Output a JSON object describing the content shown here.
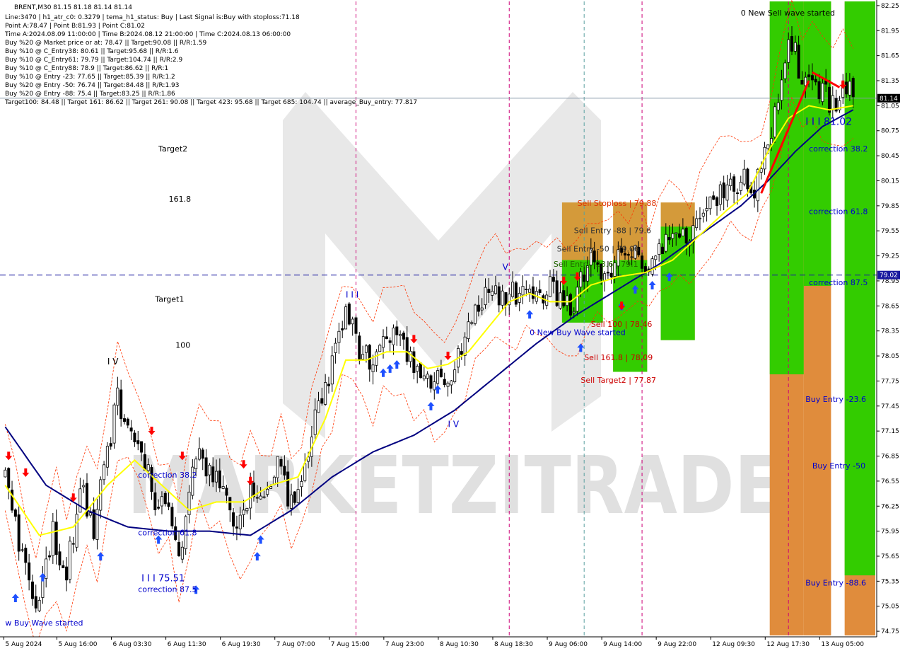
{
  "info": {
    "title": "BRENT,M30  81.15 81.18 81.14 81.14",
    "lines": [
      "Line:3470 | h1_atr_c0: 0.3279 | tema_h1_status: Buy | Last Signal is:Buy with stoploss:71.18",
      "Point A:78.47 | Point B:81.93 | Point C:81.02",
      "Time A:2024.08.09 11:00:00 | Time B:2024.08.12 21:00:00 | Time C:2024.08.13 06:00:00",
      "Buy %20 @ Market price or at: 78.47 || Target:90.08 || R/R:1.59",
      "Buy %10 @ C_Entry38: 80.61 || Target:95.68 || R/R:1.6",
      "Buy %10 @ C_Entry61: 79.79 || Target:104.74 || R/R:2.9",
      "Buy %10 @ C_Entry88: 78.9 || Target:86.62 || R/R:1",
      "Buy %10 @ Entry -23: 77.65 || Target:85.39 || R/R:1.2",
      "Buy %20 @ Entry -50: 76.74 || Target:84.48 || R/R:1.93",
      "Buy %20 @ Entry -88: 75.4 || Target:83.25 || R/R:1.86",
      "Target100: 84.48 || Target 161: 86.62 || Target 261: 90.08 || Target 423: 95.68 || Target 685: 104.74 || average_Buy_entry: 77.817"
    ]
  },
  "colors": {
    "candle": "#000000",
    "ma_slow": "#000080",
    "ma_fast": "#ffff00",
    "green_zone": "#33cc00",
    "orange_zone": "#e08c3c",
    "buy_arrow": "#1e50ff",
    "sell_arrow": "#ff0000",
    "channel": "#ff3300",
    "watermark": "#d9d9d9",
    "blue_text": "#0000cc",
    "red_text": "#cc0000"
  },
  "chart_data": {
    "type": "candlestick",
    "symbol": "BRENT",
    "timeframe": "M30",
    "ylim": [
      74.7,
      82.3
    ],
    "price_ticks": [
      82.25,
      81.95,
      81.65,
      81.35,
      81.05,
      80.75,
      80.45,
      80.15,
      79.85,
      79.55,
      79.25,
      78.95,
      78.65,
      78.35,
      78.05,
      77.75,
      77.45,
      77.15,
      76.85,
      76.55,
      76.25,
      75.95,
      75.65,
      75.35,
      75.05,
      74.75
    ],
    "price_tick_labels": [
      "82.25",
      "81.95",
      "81.65",
      "81.35",
      "81.05",
      "80.75",
      "80.45",
      "80.15",
      "79.85",
      "79.55",
      "79.25",
      "78.95",
      "78.65",
      "78.35",
      "78.05",
      "77.75",
      "77.45",
      "77.15",
      "76.85",
      "76.55",
      "76.25",
      "75.95",
      "75.65",
      "75.35",
      "75.05",
      "74.75"
    ],
    "time_labels": [
      "5 Aug 2024",
      "5 Aug 16:00",
      "6 Aug 03:30",
      "6 Aug 11:30",
      "6 Aug 19:30",
      "7 Aug 07:00",
      "7 Aug 15:00",
      "7 Aug 23:00",
      "8 Aug 10:30",
      "8 Aug 18:30",
      "9 Aug 06:00",
      "9 Aug 14:00",
      "9 Aug 22:00",
      "12 Aug 09:30",
      "12 Aug 17:30",
      "13 Aug 05:00"
    ],
    "time_label_bars": [
      0,
      16,
      32,
      48,
      64,
      80,
      96,
      112,
      128,
      144,
      160,
      176,
      192,
      208,
      224,
      240
    ],
    "bar_count": 250,
    "current_price": 81.14,
    "current_price_label": "81.14",
    "level_line": 79.02,
    "level_line_label": "79.02",
    "close_path": [
      [
        0,
        76.6
      ],
      [
        6,
        75.5
      ],
      [
        10,
        75.1
      ],
      [
        14,
        75.9
      ],
      [
        18,
        75.4
      ],
      [
        22,
        76.5
      ],
      [
        26,
        76.0
      ],
      [
        30,
        76.9
      ],
      [
        33,
        77.6
      ],
      [
        36,
        77.1
      ],
      [
        40,
        77.0
      ],
      [
        44,
        76.3
      ],
      [
        48,
        76.2
      ],
      [
        52,
        75.7
      ],
      [
        56,
        76.9
      ],
      [
        60,
        76.6
      ],
      [
        64,
        76.4
      ],
      [
        68,
        76.1
      ],
      [
        72,
        76.4
      ],
      [
        76,
        76.5
      ],
      [
        80,
        76.7
      ],
      [
        84,
        76.3
      ],
      [
        88,
        76.8
      ],
      [
        92,
        77.4
      ],
      [
        96,
        78.0
      ],
      [
        100,
        78.6
      ],
      [
        104,
        78.1
      ],
      [
        108,
        78.0
      ],
      [
        112,
        78.2
      ],
      [
        116,
        78.3
      ],
      [
        120,
        78.0
      ],
      [
        124,
        77.8
      ],
      [
        128,
        77.7
      ],
      [
        132,
        77.9
      ],
      [
        136,
        78.3
      ],
      [
        140,
        78.7
      ],
      [
        144,
        78.9
      ],
      [
        147,
        78.7
      ],
      [
        150,
        78.8
      ],
      [
        154,
        78.9
      ],
      [
        157,
        78.8
      ],
      [
        160,
        78.95
      ],
      [
        164,
        78.6
      ],
      [
        168,
        78.8
      ],
      [
        172,
        79.2
      ],
      [
        176,
        78.9
      ],
      [
        180,
        79.2
      ],
      [
        184,
        79.4
      ],
      [
        188,
        79.1
      ],
      [
        192,
        79.3
      ],
      [
        196,
        79.4
      ],
      [
        200,
        79.5
      ],
      [
        204,
        79.7
      ],
      [
        208,
        79.9
      ],
      [
        212,
        80.0
      ],
      [
        216,
        80.2
      ],
      [
        220,
        80.0
      ],
      [
        223,
        80.4
      ],
      [
        226,
        81.0
      ],
      [
        229,
        81.6
      ],
      [
        231,
        81.75
      ],
      [
        234,
        81.4
      ],
      [
        237,
        81.35
      ],
      [
        240,
        81.2
      ],
      [
        243,
        81.0
      ],
      [
        246,
        81.3
      ],
      [
        249,
        81.14
      ]
    ],
    "ma_slow_path": [
      [
        0,
        77.2
      ],
      [
        12,
        76.5
      ],
      [
        24,
        76.2
      ],
      [
        36,
        76.0
      ],
      [
        48,
        75.95
      ],
      [
        60,
        75.95
      ],
      [
        72,
        75.9
      ],
      [
        84,
        76.2
      ],
      [
        96,
        76.6
      ],
      [
        108,
        76.9
      ],
      [
        120,
        77.1
      ],
      [
        132,
        77.4
      ],
      [
        144,
        77.8
      ],
      [
        156,
        78.2
      ],
      [
        168,
        78.55
      ],
      [
        180,
        78.85
      ],
      [
        192,
        79.15
      ],
      [
        204,
        79.5
      ],
      [
        216,
        79.85
      ],
      [
        224,
        80.15
      ],
      [
        232,
        80.5
      ],
      [
        240,
        80.8
      ],
      [
        249,
        81.0
      ]
    ],
    "ma_fast_path": [
      [
        0,
        76.5
      ],
      [
        10,
        75.9
      ],
      [
        20,
        76.0
      ],
      [
        30,
        76.5
      ],
      [
        38,
        76.8
      ],
      [
        46,
        76.5
      ],
      [
        54,
        76.2
      ],
      [
        62,
        76.3
      ],
      [
        70,
        76.3
      ],
      [
        78,
        76.5
      ],
      [
        86,
        76.6
      ],
      [
        94,
        77.3
      ],
      [
        100,
        78.0
      ],
      [
        106,
        78.0
      ],
      [
        112,
        78.1
      ],
      [
        118,
        78.1
      ],
      [
        124,
        77.9
      ],
      [
        130,
        77.95
      ],
      [
        136,
        78.1
      ],
      [
        142,
        78.4
      ],
      [
        148,
        78.7
      ],
      [
        154,
        78.8
      ],
      [
        160,
        78.7
      ],
      [
        166,
        78.7
      ],
      [
        172,
        78.9
      ],
      [
        180,
        79.0
      ],
      [
        188,
        79.05
      ],
      [
        196,
        79.2
      ],
      [
        204,
        79.5
      ],
      [
        212,
        79.8
      ],
      [
        218,
        80.0
      ],
      [
        224,
        80.5
      ],
      [
        230,
        80.9
      ],
      [
        236,
        81.05
      ],
      [
        242,
        81.0
      ],
      [
        249,
        81.05
      ]
    ]
  },
  "vertical_lines": [
    {
      "bar": 103,
      "color": "#cc0077"
    },
    {
      "bar": 148,
      "color": "#cc0077"
    },
    {
      "bar": 170,
      "color": "#5aa0a0"
    },
    {
      "bar": 187,
      "color": "#cc0077"
    },
    {
      "bar": 230,
      "color": "#cc0077"
    }
  ],
  "zones": [
    {
      "bar_from": 164,
      "bar_to": 175,
      "price_from": 78.45,
      "price_to": 79.89,
      "color": "#d49a3a"
    },
    {
      "bar_from": 164,
      "bar_to": 175,
      "price_from": 78.45,
      "price_to": 79.2,
      "color": "#33cc00"
    },
    {
      "bar_from": 179,
      "bar_to": 188,
      "price_from": 77.86,
      "price_to": 79.89,
      "color": "#d49a3a"
    },
    {
      "bar_from": 179,
      "bar_to": 188,
      "price_from": 77.86,
      "price_to": 79.2,
      "color": "#33cc00"
    },
    {
      "bar_from": 193,
      "bar_to": 202,
      "price_from": 78.24,
      "price_to": 79.89,
      "color": "#d49a3a"
    },
    {
      "bar_from": 193,
      "bar_to": 202,
      "price_from": 78.24,
      "price_to": 79.6,
      "color": "#33cc00"
    },
    {
      "bar_from": 225,
      "bar_to": 234,
      "price_from": 74.7,
      "price_to": 82.3,
      "color": "#e08c3c"
    },
    {
      "bar_from": 225,
      "bar_to": 234,
      "price_from": 77.83,
      "price_to": 82.3,
      "color": "#33cc00"
    },
    {
      "bar_from": 235,
      "bar_to": 242,
      "price_from": 74.7,
      "price_to": 82.3,
      "color": "#e08c3c"
    },
    {
      "bar_from": 235,
      "bar_to": 242,
      "price_from": 78.89,
      "price_to": 82.3,
      "color": "#33cc00"
    },
    {
      "bar_from": 247,
      "bar_to": 256,
      "price_from": 74.7,
      "price_to": 82.3,
      "color": "#e08c3c"
    },
    {
      "bar_from": 247,
      "bar_to": 256,
      "price_from": 75.42,
      "price_to": 82.3,
      "color": "#33cc00"
    }
  ],
  "annotations": [
    {
      "text": "0 New Sell wave started",
      "bar": 216,
      "price": 82.13,
      "color": "#000000",
      "size": 11
    },
    {
      "text": "Target2",
      "bar": 45,
      "price": 80.5,
      "color": "#000000",
      "size": 11
    },
    {
      "text": "161.8",
      "bar": 48,
      "price": 79.9,
      "color": "#000000",
      "size": 11
    },
    {
      "text": "Target1",
      "bar": 44,
      "price": 78.7,
      "color": "#000000",
      "size": 11
    },
    {
      "text": "100",
      "bar": 50,
      "price": 78.15,
      "color": "#000000",
      "size": 11
    },
    {
      "text": "I V",
      "bar": 30,
      "price": 77.95,
      "color": "#000000",
      "size": 12
    },
    {
      "text": "I I I",
      "bar": 100,
      "price": 78.75,
      "color": "#0000cc",
      "size": 12
    },
    {
      "text": "V",
      "bar": 146,
      "price": 79.08,
      "color": "#0000cc",
      "size": 12
    },
    {
      "text": "I V",
      "bar": 130,
      "price": 77.2,
      "color": "#0000cc",
      "size": 12
    },
    {
      "text": "Sell Stoploss | 79.88",
      "bar": 168,
      "price": 79.85,
      "color": "#e03000",
      "size": 11
    },
    {
      "text": "Sell Entry -88 | 79.6",
      "bar": 167,
      "price": 79.52,
      "color": "#333333",
      "size": 11
    },
    {
      "text": "Sell Entry -50 | 79.06",
      "bar": 162,
      "price": 79.3,
      "color": "#333333",
      "size": 11
    },
    {
      "text": "Sell Entry -23.6 | 79.1",
      "bar": 161,
      "price": 79.12,
      "color": "#226600",
      "size": 11
    },
    {
      "text": "Sell 100 | 78.46",
      "bar": 172,
      "price": 78.4,
      "color": "#cc0000",
      "size": 11
    },
    {
      "text": "0 New Buy Wave started",
      "bar": 154,
      "price": 78.3,
      "color": "#0000cc",
      "size": 11
    },
    {
      "text": "Sell 161.8 | 78.09",
      "bar": 170,
      "price": 78.0,
      "color": "#cc0000",
      "size": 11
    },
    {
      "text": "Sell Target2 | 77.87",
      "bar": 169,
      "price": 77.73,
      "color": "#cc0000",
      "size": 11
    },
    {
      "text": "correction 38.2",
      "bar": 39,
      "price": 76.59,
      "color": "#0000cc",
      "size": 11
    },
    {
      "text": "correction 61.8",
      "bar": 39,
      "price": 75.9,
      "color": "#0000cc",
      "size": 11
    },
    {
      "text": "correction 87.5",
      "bar": 39,
      "price": 75.22,
      "color": "#0000cc",
      "size": 11
    },
    {
      "text": "I I I 75.51",
      "bar": 40,
      "price": 75.35,
      "color": "#0000cc",
      "size": 13
    },
    {
      "text": "w Buy Wave started",
      "bar": 0,
      "price": 74.82,
      "color": "#0000cc",
      "size": 11
    },
    {
      "text": "I I I 81.02",
      "bar": 235,
      "price": 80.82,
      "color": "#0000cc",
      "size": 14
    },
    {
      "text": "correction 38.2",
      "bar": 236,
      "price": 80.5,
      "color": "#0000cc",
      "size": 11
    },
    {
      "text": "correction 61.8",
      "bar": 236,
      "price": 79.75,
      "color": "#0000cc",
      "size": 11
    },
    {
      "text": "correction 87.5",
      "bar": 236,
      "price": 78.9,
      "color": "#0000cc",
      "size": 11
    },
    {
      "text": "Buy Entry -23.6",
      "bar": 235,
      "price": 77.5,
      "color": "#0000cc",
      "size": 11
    },
    {
      "text": "Buy Entry -50",
      "bar": 237,
      "price": 76.7,
      "color": "#0000cc",
      "size": 11
    },
    {
      "text": "Buy Entry -88.6",
      "bar": 235,
      "price": 75.3,
      "color": "#0000cc",
      "size": 11
    }
  ],
  "buy_arrows": [
    [
      3,
      75.2
    ],
    [
      11,
      75.45
    ],
    [
      28,
      75.7
    ],
    [
      45,
      75.9
    ],
    [
      56,
      75.3
    ],
    [
      74,
      75.7
    ],
    [
      75,
      75.9
    ],
    [
      111,
      77.9
    ],
    [
      113,
      77.95
    ],
    [
      115,
      78.0
    ],
    [
      125,
      77.5
    ],
    [
      127,
      77.7
    ],
    [
      154,
      78.6
    ],
    [
      169,
      78.2
    ],
    [
      181,
      78.7
    ],
    [
      185,
      78.9
    ],
    [
      190,
      78.95
    ],
    [
      195,
      79.05
    ]
  ],
  "sell_arrows": [
    [
      1,
      76.8
    ],
    [
      6,
      76.6
    ],
    [
      20,
      76.3
    ],
    [
      43,
      77.1
    ],
    [
      52,
      76.8
    ],
    [
      70,
      76.7
    ],
    [
      72,
      76.5
    ],
    [
      120,
      78.2
    ],
    [
      130,
      78.0
    ],
    [
      164,
      78.9
    ],
    [
      168,
      78.95
    ],
    [
      181,
      78.6
    ],
    [
      246,
      81.25
    ]
  ],
  "trend_line_red": [
    [
      222,
      80.0
    ],
    [
      236,
      81.35
    ]
  ],
  "trend_line_red2": [
    [
      237,
      81.45
    ],
    [
      245,
      81.27
    ]
  ],
  "watermark_text": "MARKETZITRADE"
}
